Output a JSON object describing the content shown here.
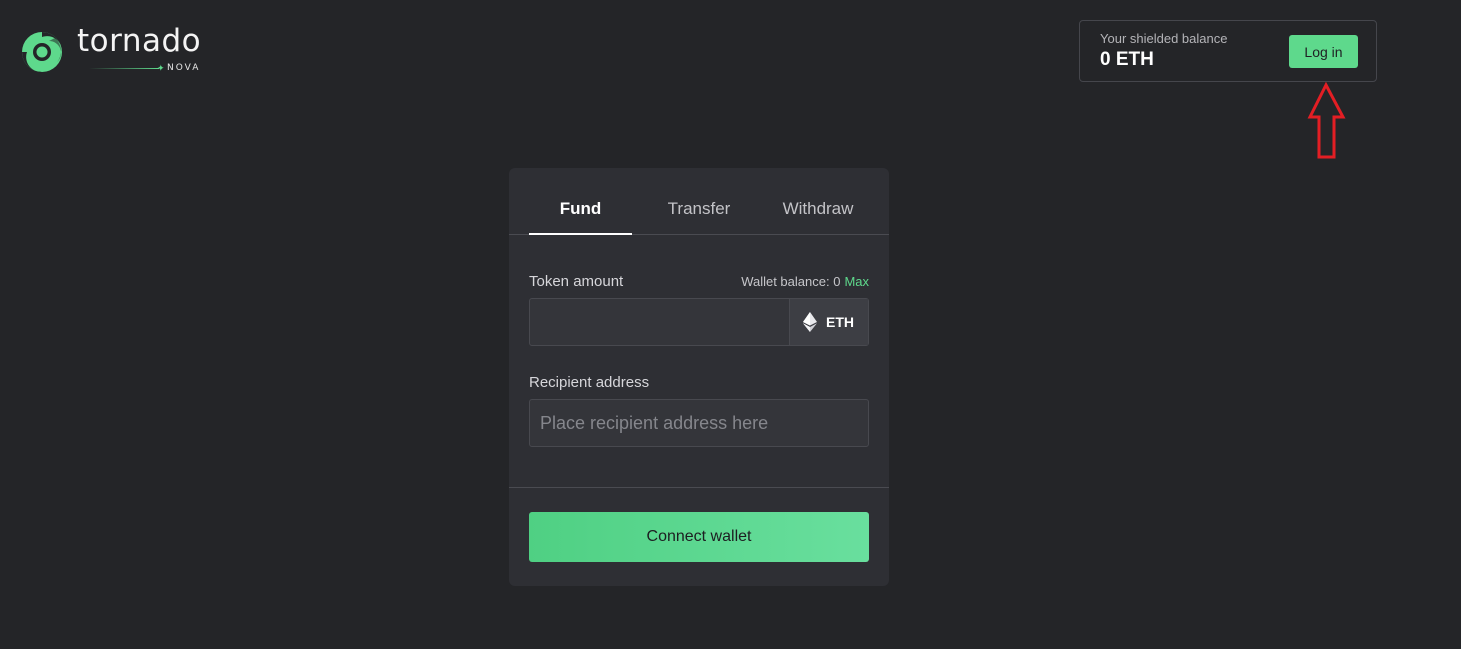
{
  "logo": {
    "word": "tornado",
    "sub": "NOVA",
    "icon": "tornado-swirl-icon",
    "brand_color": "#5ed98c"
  },
  "balance": {
    "label": "Your shielded balance",
    "value": "0 ETH",
    "login_label": "Log in"
  },
  "annotation": {
    "icon": "up-arrow-icon",
    "color": "#e31e24"
  },
  "tabs": [
    {
      "label": "Fund",
      "active": true
    },
    {
      "label": "Transfer",
      "active": false
    },
    {
      "label": "Withdraw",
      "active": false
    }
  ],
  "token": {
    "label": "Token amount",
    "wallet_balance": "Wallet balance: 0",
    "max_label": "Max",
    "amount_value": "",
    "symbol": "ETH",
    "icon": "ethereum-icon"
  },
  "recipient": {
    "label": "Recipient address",
    "placeholder": "Place recipient address here",
    "value": ""
  },
  "connect": {
    "label": "Connect wallet"
  }
}
